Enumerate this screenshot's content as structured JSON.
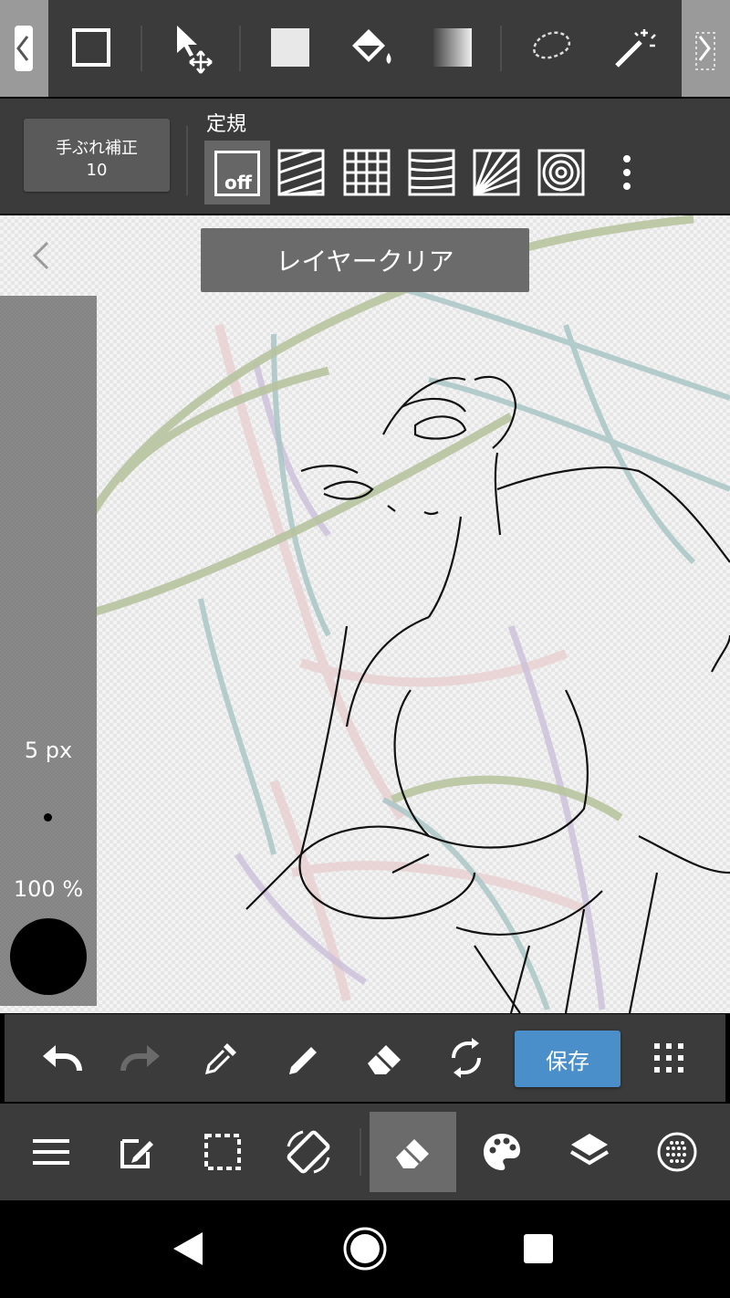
{
  "top_toolbar": {
    "tools": [
      {
        "name": "rectangle-select",
        "icon": "square-outline-icon"
      },
      {
        "name": "move",
        "icon": "move-arrow-icon"
      },
      {
        "name": "fill-color",
        "icon": "filled-square-icon"
      },
      {
        "name": "bucket",
        "icon": "paint-bucket-icon"
      },
      {
        "name": "gradient",
        "icon": "gradient-icon"
      },
      {
        "name": "lasso",
        "icon": "lasso-icon"
      },
      {
        "name": "magic-wand",
        "icon": "magic-wand-icon"
      }
    ]
  },
  "ruler_bar": {
    "stabilizer_label": "手ぶれ補正",
    "stabilizer_value": "10",
    "ruler_label": "定規",
    "off_label": "off"
  },
  "canvas": {
    "toast": "レイヤークリア"
  },
  "side_panel": {
    "brush_size": "5 px",
    "opacity": "100 %",
    "brush_color": "#000000"
  },
  "action_bar": {
    "save_label": "保存"
  },
  "colors": {
    "toolbar_bg": "#3b3b3b",
    "save_button": "#4a8fc9",
    "active_tab": "#6b6b6b"
  }
}
